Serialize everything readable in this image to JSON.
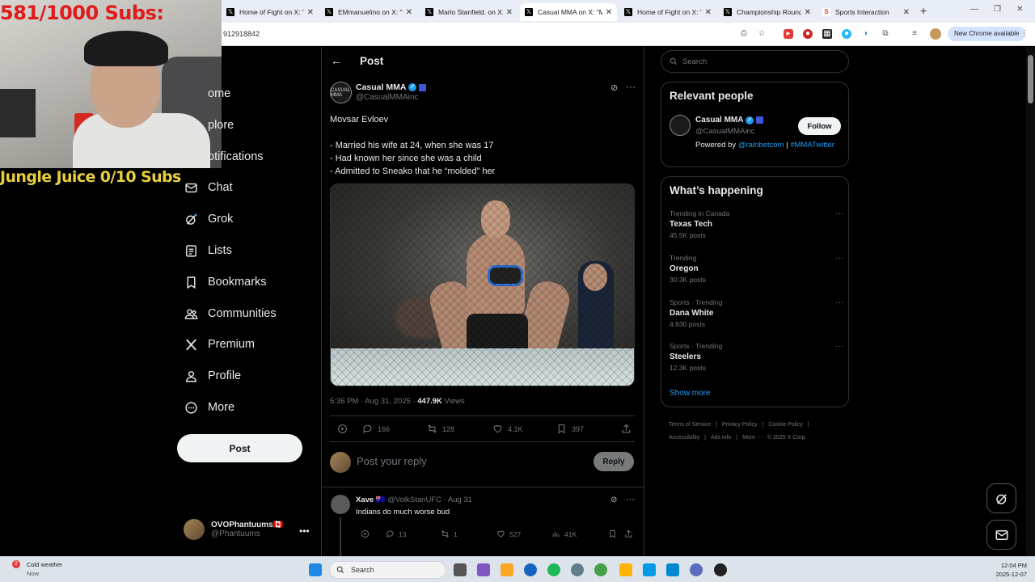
{
  "browser": {
    "tabs": [
      {
        "title": "Home of Fight on X: \"",
        "icon": "x-logo",
        "active": false
      },
      {
        "title": "EMmanuelino on X: \"",
        "icon": "x-logo",
        "active": false
      },
      {
        "title": "Marlo Stanfield. on X:",
        "icon": "x-logo",
        "active": false
      },
      {
        "title": "Casual MMA on X: \"M",
        "icon": "x-logo",
        "active": true
      },
      {
        "title": "Home of Fight on X: \"",
        "icon": "x-logo",
        "active": false
      },
      {
        "title": "Championship Round",
        "icon": "x-logo",
        "active": false
      },
      {
        "title": "Sports Interaction",
        "icon": "sports-logo",
        "active": false
      }
    ],
    "url_fragment": "912918842",
    "new_chrome_label": "New Chrome available"
  },
  "overlay": {
    "subs_counter": "581/1000  Subs:",
    "juice_counter": "Jungle Juice 0/10 Subs"
  },
  "nav": {
    "items": [
      {
        "label": "ome",
        "icon": "home-icon"
      },
      {
        "label": "plore",
        "icon": "explore-icon"
      },
      {
        "label": "otifications",
        "icon": "bell-icon"
      },
      {
        "label": "Chat",
        "icon": "mail-icon"
      },
      {
        "label": "Grok",
        "icon": "grok-icon"
      },
      {
        "label": "Lists",
        "icon": "list-icon"
      },
      {
        "label": "Bookmarks",
        "icon": "bookmark-icon"
      },
      {
        "label": "Communities",
        "icon": "people-icon"
      },
      {
        "label": "Premium",
        "icon": "x-logo-icon"
      },
      {
        "label": "Profile",
        "icon": "person-icon"
      },
      {
        "label": "More",
        "icon": "more-circle-icon"
      }
    ],
    "post_button": "Post",
    "me": {
      "name": "OVOPhantuums🇨🇦",
      "handle": "@Phantuums"
    }
  },
  "post": {
    "header_title": "Post",
    "author_name": "Casual MMA",
    "author_handle": "@CasualMMAinc",
    "avatar_text": "CASUAL MMA",
    "text": "Movsar Evloev\n\n- Married his wife at 24, when she was 17\n- Had known her since she was a child\n- Admitted to Sneako that he “molded” her",
    "time": "5:36 PM · Aug 31, 2025 · ",
    "views": "447.9K",
    "views_label": " Views",
    "replies": "166",
    "reposts": "128",
    "likes": "4.1K",
    "bookmarks": "397",
    "reply_placeholder": "Post your reply",
    "reply_button": "Reply"
  },
  "reply": {
    "name": "Xave 🇦🇺",
    "meta": " @VolkStanUFC · Aug 31",
    "text": "Indians do much worse bud",
    "replies": "13",
    "reposts": "1",
    "likes": "527",
    "views": "41K"
  },
  "sidebar": {
    "search_placeholder": "Search",
    "relevant_title": "Relevant people",
    "relevant": {
      "name": "Casual MMA",
      "handle": "@CasualMMAinc",
      "follow": "Follow",
      "bio_prefix": "Powered by ",
      "bio_link1": "@rainbetcom",
      "bio_sep": " | ",
      "bio_link2": "#MMATwitter"
    },
    "happening_title": "What’s happening",
    "trends": [
      {
        "context": "Trending in Canada",
        "topic": "Texas Tech",
        "count": "45.5K posts"
      },
      {
        "context": "Trending",
        "topic": "Oregon",
        "count": "30.3K posts"
      },
      {
        "context": "Sports · Trending",
        "topic": "Dana White",
        "count": "4,930 posts"
      },
      {
        "context": "Sports · Trending",
        "topic": "Steelers",
        "count": "12.3K posts"
      }
    ],
    "show_more": "Show more",
    "footer": [
      "Terms of Service",
      "|",
      "Privacy Policy",
      "|",
      "Cookie Policy",
      "|",
      "Accessibility",
      "|",
      "Ads info",
      "|",
      "More ···",
      "© 2025 X Corp."
    ]
  },
  "taskbar": {
    "weather_title": "Cold weather",
    "weather_sub": "Now",
    "weather_badge": "2",
    "search": "Search",
    "time": "12:04 PM",
    "date": "2025-12-07"
  },
  "colors": {
    "accent": "#1d9bf0",
    "background": "#000000",
    "overlay_red": "#e01b1b",
    "overlay_yellow": "#e8cf3a"
  }
}
